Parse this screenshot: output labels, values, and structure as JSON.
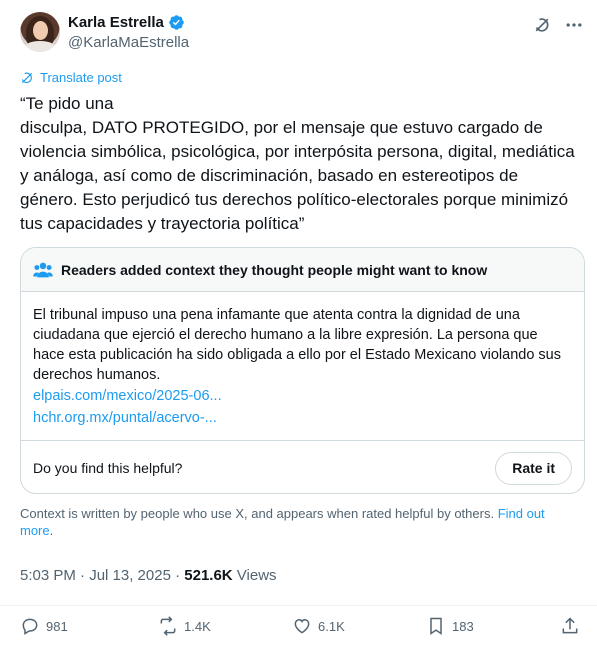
{
  "author": {
    "name": "Karla Estrella",
    "handle": "@KarlaMaEstrella",
    "verified_color": "#1d9bf0"
  },
  "header_icons": [
    "grok-icon",
    "more-icon"
  ],
  "translate_label": "Translate post",
  "post_text": "“Te pido una\ndisculpa, DATO PROTEGIDO, por el mensaje que estuvo cargado de violencia simbólica, psicológica, por interpósita persona, digital, mediática y análoga, así como de discriminación, basado en estereotipos de género. Esto perjudicó tus derechos político-electorales porque minimizó tus capacidades y trayectoria política”",
  "community_note": {
    "heading": "Readers added context they thought people might want to know",
    "body": "El tribunal impuso una pena infamante que atenta contra la dignidad de una ciudadana que ejerció el derecho humano a la libre expresión.  La persona que hace esta publicación ha sido obligada a ello por el Estado Mexicano violando sus derechos humanos.",
    "links": [
      "elpais.com/mexico/2025-06...",
      "hchr.org.mx/puntal/acervo-..."
    ],
    "helpful_question": "Do you find this helpful?",
    "rate_label": "Rate it"
  },
  "context_text": "Context is written by people who use X, and appears when rated helpful by others.",
  "context_link": "Find out more",
  "context_end": ".",
  "meta": {
    "timestamp": "5:03 PM · Jul 13, 2025 · ",
    "views_count": "521.6K",
    "views_label": " Views"
  },
  "actions": {
    "replies": "981",
    "reposts": "1.4K",
    "likes": "6.1K",
    "bookmarks": "183"
  },
  "colors": {
    "accent": "#1d9bf0",
    "muted": "#536471",
    "border": "#cfd9de"
  }
}
